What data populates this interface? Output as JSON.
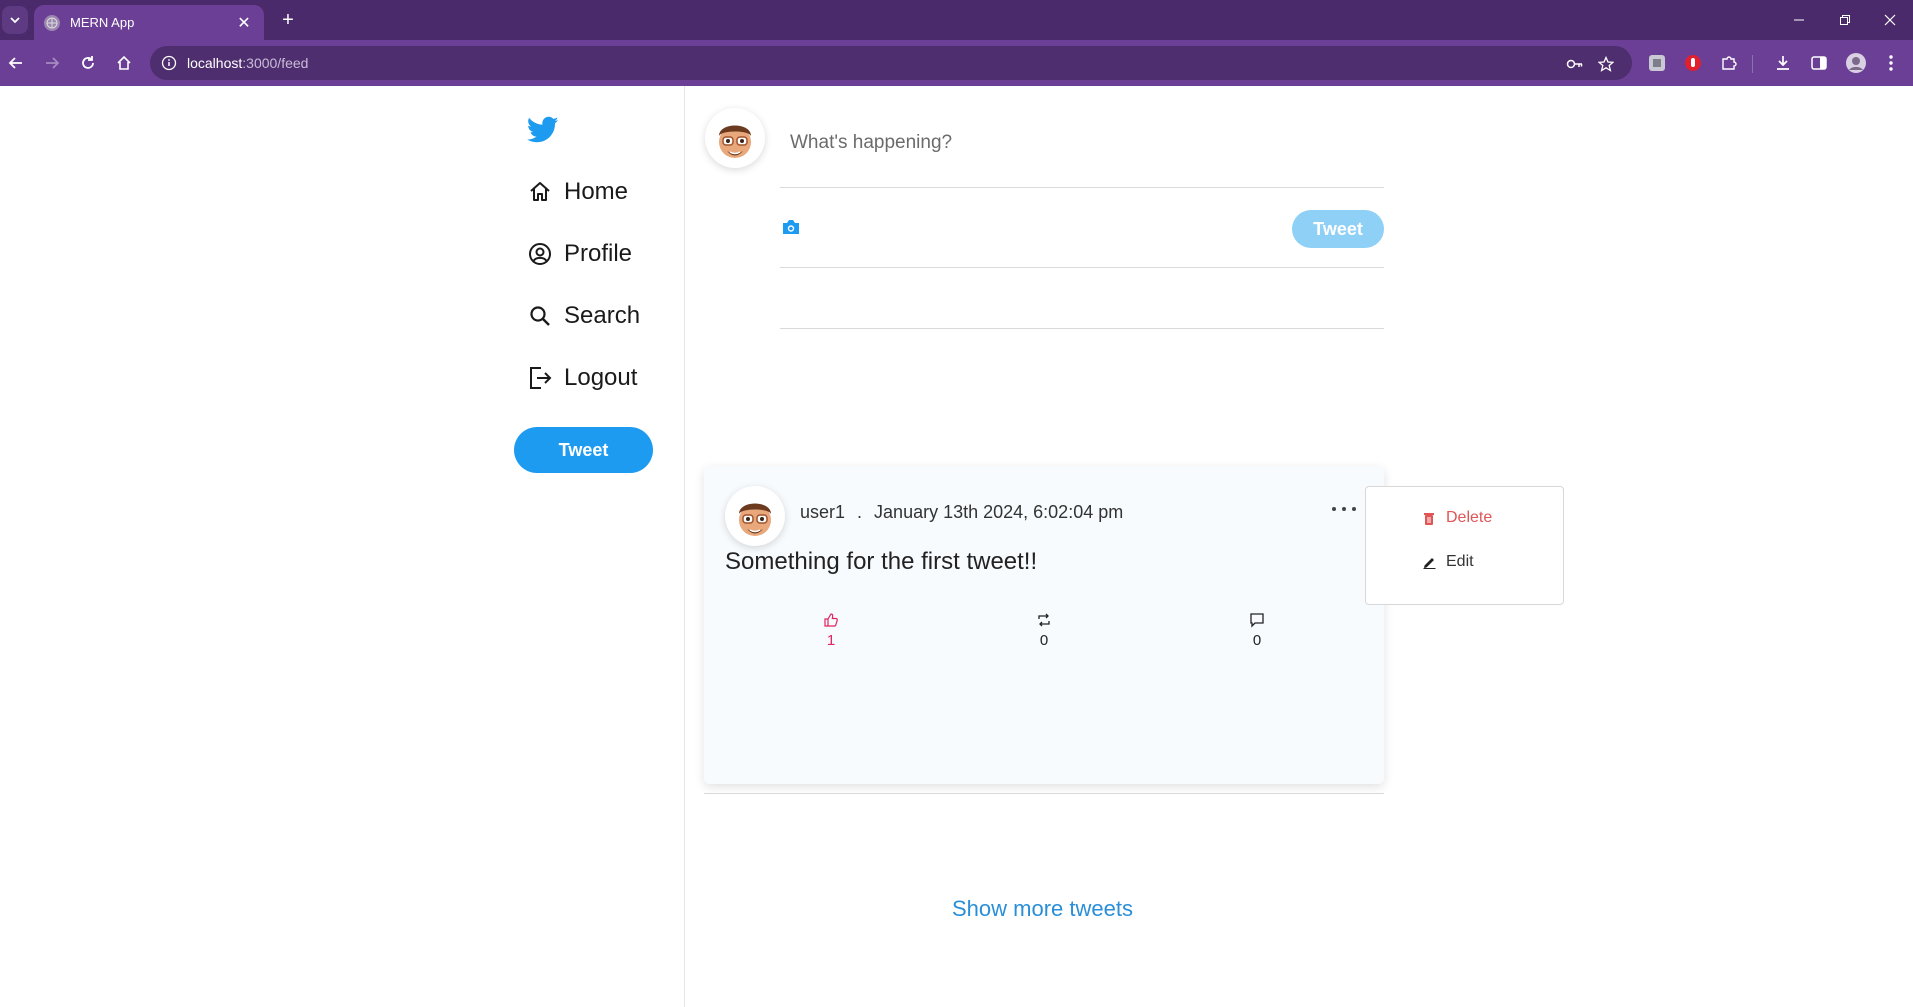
{
  "browser": {
    "tab_title": "MERN App",
    "url_host": "localhost",
    "url_path": ":3000/feed"
  },
  "sidebar": {
    "items": [
      {
        "label": "Home",
        "icon": "home-icon"
      },
      {
        "label": "Profile",
        "icon": "user-circle-icon"
      },
      {
        "label": "Search",
        "icon": "search-icon"
      },
      {
        "label": "Logout",
        "icon": "logout-icon"
      }
    ],
    "tweet_button": "Tweet"
  },
  "compose": {
    "placeholder": "What's happening?",
    "tweet_button": "Tweet"
  },
  "tweet": {
    "username": "user1",
    "separator": ".",
    "timestamp": "January 13th 2024, 6:02:04 pm",
    "text": "Something for the first tweet!!",
    "likes": "1",
    "retweets": "0",
    "comments": "0"
  },
  "menu": {
    "delete_label": "Delete",
    "edit_label": "Edit"
  },
  "feed": {
    "show_more": "Show more tweets"
  },
  "colors": {
    "brand": "#1d9bf0",
    "like": "#e0245e",
    "delete": "#e05555",
    "browser_frame": "#4a2a6b"
  }
}
